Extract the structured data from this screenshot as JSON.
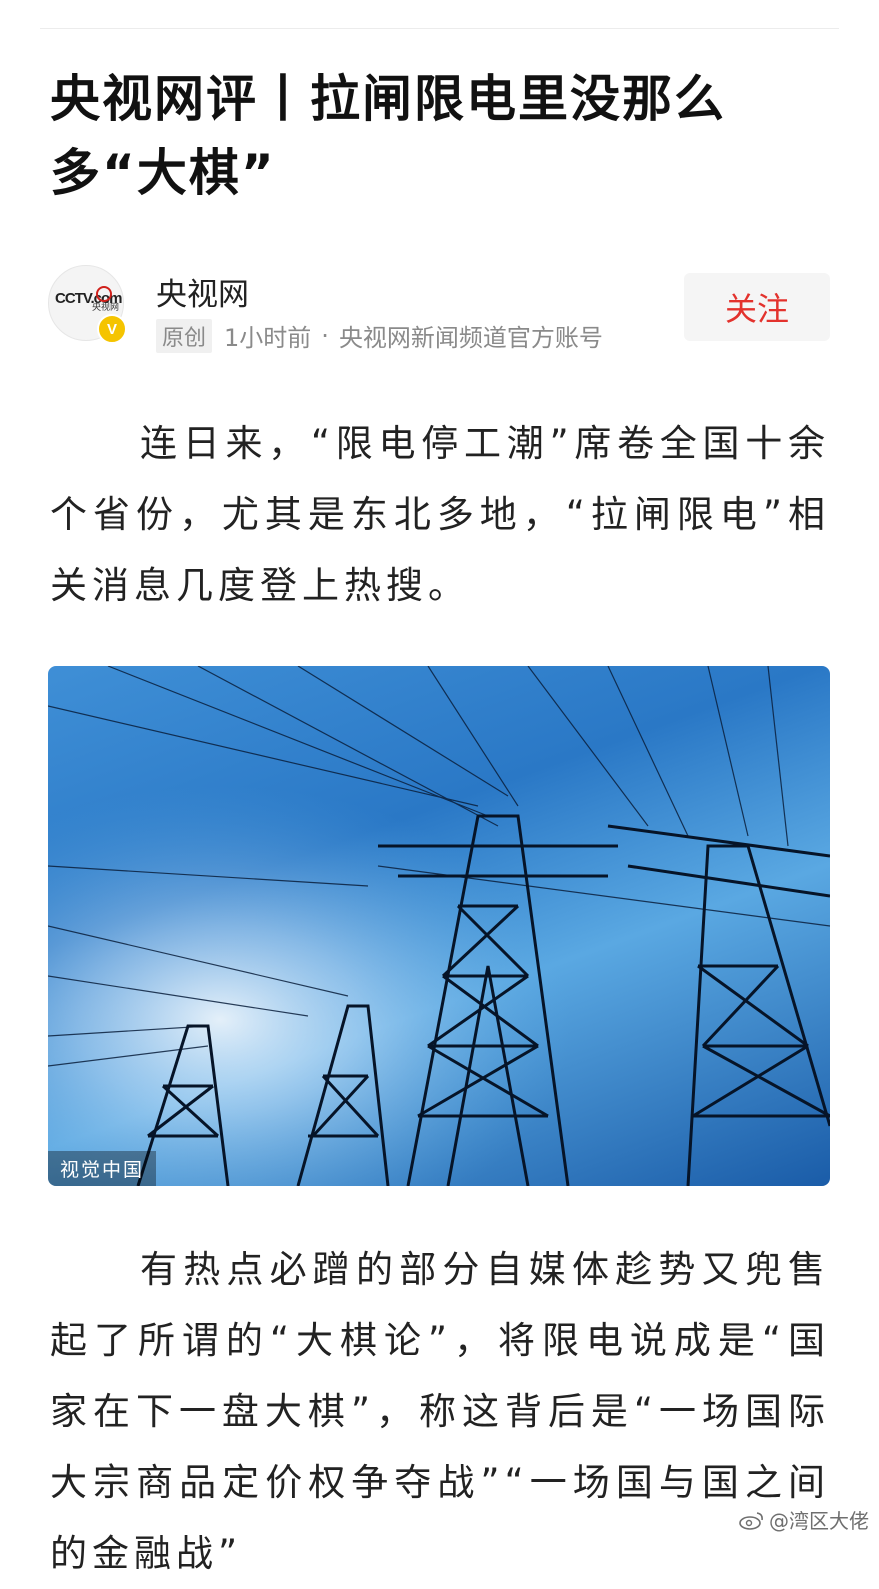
{
  "article": {
    "title": "央视网评丨拉闸限电里没那么多“大棋”",
    "author": {
      "name": "央视网",
      "avatar_logo": "CCTV.com",
      "avatar_logo_sub": "央视网",
      "verified_badge": "V",
      "original_tag": "原创",
      "time": "1小时前",
      "separator": "·",
      "source": "央视网新闻频道官方账号"
    },
    "follow_label": "关注",
    "paragraph1": "连日来，“限电停工潮”席卷全国十余个省份，尤其是东北多地，“拉闸限电”相关消息几度登上热搜。",
    "image": {
      "description_icon": "power-tower-photo",
      "credit": "视觉中国"
    },
    "paragraph2": "有热点必蹭的部分自媒体趁势又兜售起了所谓的“大棋论”，将限电说成是“国家在下一盘大棋”，称这背后是“一场国际大宗商品定价权争夺战”“一场国与国之间的金融战”"
  },
  "watermark": {
    "icon": "weibo-icon",
    "text": "@湾区大佬"
  },
  "colors": {
    "follow_text": "#e3322d",
    "badge": "#f5c400",
    "meta_text": "#8a8a8a"
  }
}
